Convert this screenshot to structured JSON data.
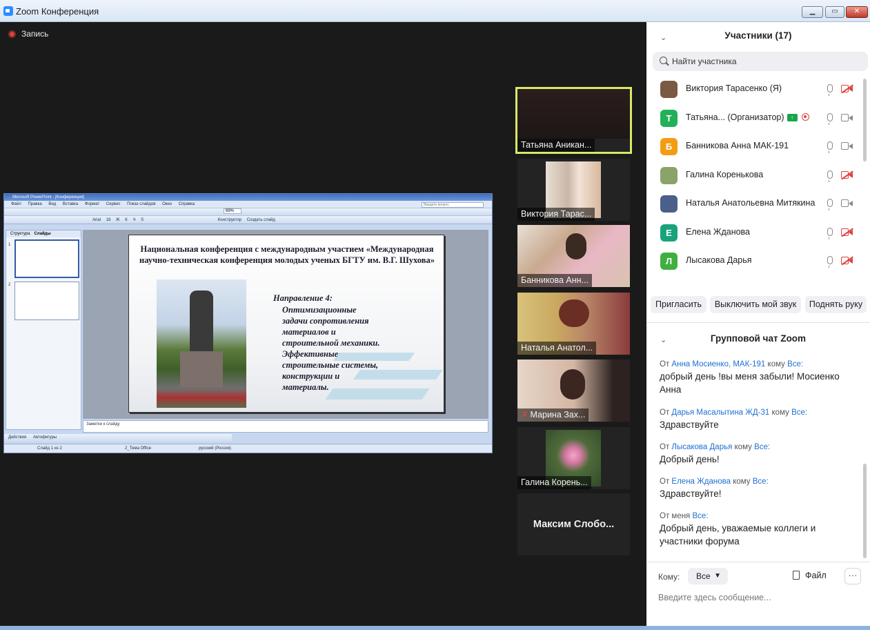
{
  "window": {
    "title": "Zoom Конференция",
    "min": "▁",
    "max": "▭",
    "close": "✕"
  },
  "recording": {
    "label": "Запись"
  },
  "shared_screen": {
    "app_title": "Microsoft PowerPoint - [Конференция]",
    "menu": [
      "Файл",
      "Правка",
      "Вид",
      "Вставка",
      "Формат",
      "Сервис",
      "Показ слайдов",
      "Окно",
      "Справка"
    ],
    "ask_placeholder": "Введите вопрос",
    "toolbar2": [
      "Arial",
      "18",
      "Ж",
      "К",
      "Ч",
      "S",
      "Конструктор",
      "Создать слайд"
    ],
    "tabs": [
      "Структура",
      "Слайды"
    ],
    "zoom": "69%",
    "slide_title": "Национальная конференция с международным участием «Международная научно-техническая конференция молодых ученых БГТУ им. В.Г. Шухова»",
    "slide_heading": "Направление 4:",
    "slide_body": "Оптимизационные\nзадачи сопротивления\nматериалов и\nстроительной механики.\nЭффективные\nстроительные системы,\nконструкции и\nматериалы.",
    "notes_placeholder": "Заметки к слайду",
    "draw_toolbar": [
      "Действия",
      "Автофигуры"
    ],
    "status": [
      "Слайд 1 из 2",
      "2_Тема Office",
      "русский (Россия)"
    ],
    "thumb_numbers": [
      "1",
      "2"
    ]
  },
  "video_tiles": [
    {
      "name": "Татьяна Аникан..."
    },
    {
      "name": "Виктория Тарас..."
    },
    {
      "name": "Банникова Анн..."
    },
    {
      "name": "Наталья Анатол..."
    },
    {
      "name": "Марина Зах..."
    },
    {
      "name": "Галина Корень..."
    },
    {
      "name": "Максим  Слобо..."
    }
  ],
  "participants": {
    "title": "Участники (17)",
    "search_placeholder": "Найти участника",
    "list": [
      {
        "name": "Виктория Тарасенко (Я)",
        "avatar_letter": "",
        "avatar_color": "#7a5a45",
        "cam_off": true
      },
      {
        "name": "Татьяна... (Организатор)",
        "avatar_letter": "T",
        "avatar_color": "#23b05a",
        "cam_off": false,
        "host": true
      },
      {
        "name": " Банникова Анна МАК-191",
        "avatar_letter": "Б",
        "avatar_color": "#f29d12",
        "cam_off": false
      },
      {
        "name": "Галина Коренькова",
        "avatar_letter": "",
        "avatar_color": "#8aa36a",
        "cam_off": true
      },
      {
        "name": "Наталья Анатольевна Митякина",
        "avatar_letter": "",
        "avatar_color": "#4a5f8a",
        "cam_off": false
      },
      {
        "name": "Елена Жданова",
        "avatar_letter": "Е",
        "avatar_color": "#1aa37a",
        "cam_off": true
      },
      {
        "name": "Лысакова Дарья",
        "avatar_letter": "Л",
        "avatar_color": "#3fb040",
        "cam_off": true
      }
    ],
    "buttons": {
      "invite": "Пригласить",
      "mute_me": "Выключить мой звук",
      "raise_hand": "Поднять руку"
    }
  },
  "chat": {
    "title": "Групповой чат Zoom",
    "messages": [
      {
        "from_prefix": "От",
        "from": "Анна Мосиенко, МАК-191",
        "to_prefix": "кому",
        "to": "Все:",
        "text": "добрый день !вы меня забыли! Мосиенко Анна"
      },
      {
        "from_prefix": "От",
        "from": "Дарья Масалытина ЖД-31",
        "to_prefix": "кому",
        "to": "Все:",
        "text": "Здравствуйте"
      },
      {
        "from_prefix": "От",
        "from": "Лысакова Дарья",
        "to_prefix": "кому",
        "to": "Все:",
        "text": "Добрый день!"
      },
      {
        "from_prefix": "От",
        "from": "Елена Жданова",
        "to_prefix": "кому",
        "to": "Все:",
        "text": "Здравствуйте!"
      },
      {
        "from_prefix": "От меня",
        "from": "",
        "to_prefix": "",
        "to": "Все:",
        "text": "Добрый день, уважаемые коллеги и участники форума"
      }
    ],
    "to_label": "Кому:",
    "to_value": "Все",
    "file_label": "Файл",
    "more_label": "···",
    "input_placeholder": "Введите здесь сообщение..."
  },
  "colors": {
    "accent": "#2d8cff",
    "link": "#1f6fd1",
    "active_speaker": "#d9e86a",
    "record": "#e0403a"
  }
}
